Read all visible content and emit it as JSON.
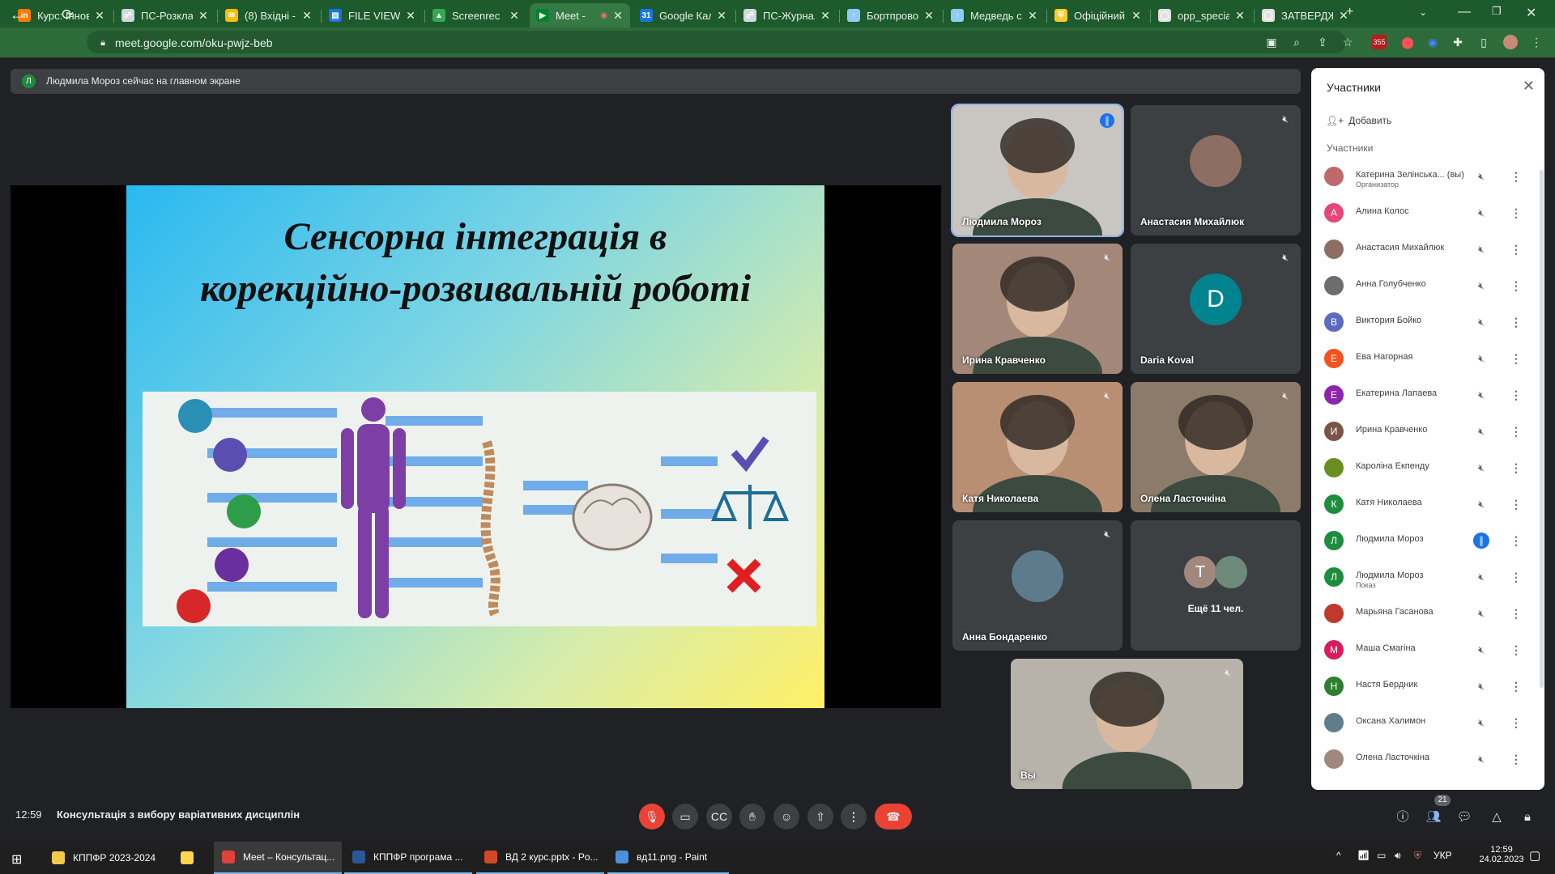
{
  "browser": {
    "tabs": [
      {
        "label": "Курс: Іннов",
        "icon_color": "#f57c00",
        "icon_text": "in"
      },
      {
        "label": "ПС-Розклад",
        "icon_color": "#cfd8dc",
        "icon_text": "☍"
      },
      {
        "label": "(8) Вхідні -",
        "icon_color": "#fbbc04",
        "icon_text": "✉"
      },
      {
        "label": "FILE VIEW",
        "icon_color": "#1a73e8",
        "icon_text": "▤"
      },
      {
        "label": "Screenrec",
        "icon_color": "#34a853",
        "icon_text": "▲"
      },
      {
        "label": "Meet -",
        "icon_color": "#00832d",
        "icon_text": "▶"
      },
      {
        "label": "Google Кал",
        "icon_color": "#1a73e8",
        "icon_text": "31"
      },
      {
        "label": "ПС-Журнал",
        "icon_color": "#cfd8dc",
        "icon_text": "☍"
      },
      {
        "label": "Бортпрово",
        "icon_color": "#90caf9",
        "icon_text": "↑"
      },
      {
        "label": "Медведь с",
        "icon_color": "#90caf9",
        "icon_text": "↑"
      },
      {
        "label": "Офіційний",
        "icon_color": "#ffca28",
        "icon_text": "⛨"
      },
      {
        "label": "opp_specia",
        "icon_color": "#e0e0e0",
        "icon_text": "◯"
      },
      {
        "label": "ЗАТВЕРДЖ",
        "icon_color": "#e0e0e0",
        "icon_text": "◯"
      }
    ],
    "url": "meet.google.com/oku-pwjz-beb",
    "extension_badge": "355"
  },
  "meet": {
    "banner_avatar": "Л",
    "banner": "Людмила Мороз сейчас на главном экране",
    "slide": {
      "title_line1": "Сенсорна інтеграція в",
      "title_line2": "корекційно-розвивальній роботі"
    },
    "tiles": [
      {
        "name": "Людмила Мороз",
        "kind": "video",
        "bg": "#c9c5c0"
      },
      {
        "name": "Анастасия Михайлюк",
        "kind": "avatar",
        "avatar_color": "#8d6e63"
      },
      {
        "name": "Ирина Кравченко",
        "kind": "video",
        "bg": "#a3887a"
      },
      {
        "name": "Daria Koval",
        "kind": "letter",
        "letter": "D",
        "avatar_color": "#00838f"
      },
      {
        "name": "Катя Николаева",
        "kind": "video",
        "bg": "#b98f74"
      },
      {
        "name": "Олена Ласточкіна",
        "kind": "video",
        "bg": "#8c7a6a"
      },
      {
        "name": "Анна Бондаренко",
        "kind": "avatar",
        "avatar_color": "#5d7b8a"
      },
      {
        "name": "Ещё 11 чел.",
        "kind": "more",
        "letter": "T"
      },
      {
        "name": "Вы",
        "kind": "video",
        "bg": "#b7b3aa"
      }
    ],
    "panel": {
      "title": "Участники",
      "add_label": "Добавить",
      "section_label": "Участники",
      "participants": [
        {
          "name": "Катерина Зелінська... (вы)",
          "sub": "Организатор",
          "letter": "",
          "color": "#bf6a6a"
        },
        {
          "name": "Алина Колос",
          "sub": "",
          "letter": "А",
          "color": "#e8457c"
        },
        {
          "name": "Анастасия Михайлюк",
          "sub": "",
          "letter": "",
          "color": "#8d6e63"
        },
        {
          "name": "Анна Голубченко",
          "sub": "",
          "letter": "",
          "color": "#6d6d6d"
        },
        {
          "name": "Виктория Бойко",
          "sub": "",
          "letter": "В",
          "color": "#5c6bc0"
        },
        {
          "name": "Ева Нагорная",
          "sub": "",
          "letter": "Е",
          "color": "#f4511e"
        },
        {
          "name": "Екатерина Лапаева",
          "sub": "",
          "letter": "Е",
          "color": "#8e24aa"
        },
        {
          "name": "Ирина Кравченко",
          "sub": "",
          "letter": "И",
          "color": "#795548"
        },
        {
          "name": "Кароліна Екпенду",
          "sub": "",
          "letter": "",
          "color": "#6b8e23"
        },
        {
          "name": "Катя Николаева",
          "sub": "",
          "letter": "К",
          "color": "#1e8e3e"
        },
        {
          "name": "Людмила Мороз",
          "sub": "",
          "letter": "Л",
          "color": "#1e8e3e"
        },
        {
          "name": "Людмила Мороз",
          "sub": "Показ",
          "letter": "Л",
          "color": "#1e8e3e"
        },
        {
          "name": "Марьяна Гасанова",
          "sub": "",
          "letter": "",
          "color": "#c0392b"
        },
        {
          "name": "Маша Смагіна",
          "sub": "",
          "letter": "М",
          "color": "#d81b60"
        },
        {
          "name": "Настя Бердник",
          "sub": "",
          "letter": "Н",
          "color": "#2e7d32"
        },
        {
          "name": "Оксана Халимон",
          "sub": "",
          "letter": "",
          "color": "#607d8b"
        },
        {
          "name": "Олена Ласточкіна",
          "sub": "",
          "letter": "",
          "color": "#a1887f"
        }
      ]
    },
    "bottom": {
      "time": "12:59",
      "title": "Консультація з вибору варіативних дисциплін",
      "people_count": "21"
    }
  },
  "taskbar": {
    "items": [
      {
        "label": "КППФР 2023-2024",
        "icon_color": "#f2c94c"
      },
      {
        "label": "",
        "icon_color": "#ffd54f"
      },
      {
        "label": "Meet – Консультац...",
        "icon_color": "#db4437"
      },
      {
        "label": "КППФР програма ...",
        "icon_color": "#2b579a"
      },
      {
        "label": "ВД 2 курс.pptx - Po...",
        "icon_color": "#d24726"
      },
      {
        "label": "вд11.png - Paint",
        "icon_color": "#4a90d9"
      }
    ],
    "lang": "УКР",
    "time": "12:59",
    "date": "24.02.2023"
  }
}
